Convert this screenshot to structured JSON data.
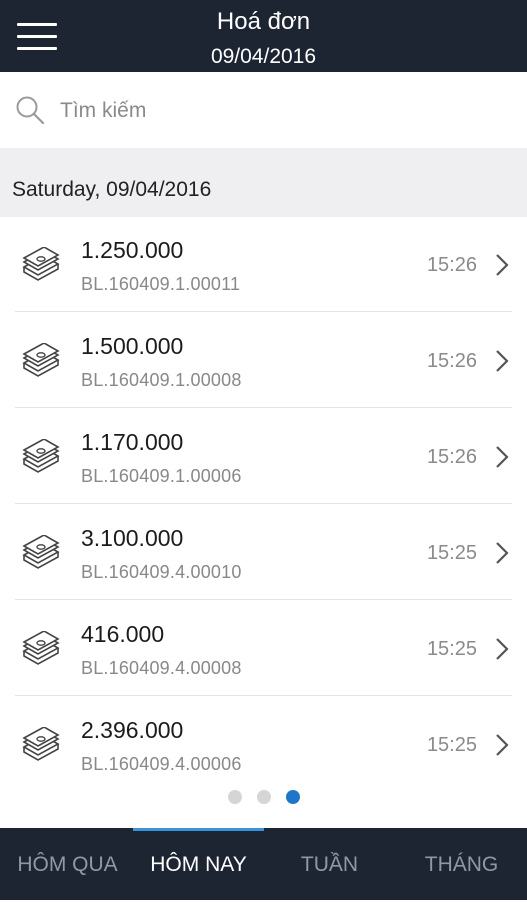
{
  "header": {
    "title": "Hoá đơn",
    "date": "09/04/2016"
  },
  "search": {
    "placeholder": "Tìm kiếm",
    "icon": "search-icon"
  },
  "section": {
    "label": "Saturday, 09/04/2016"
  },
  "invoices": [
    {
      "amount": "1.250.000",
      "code": "BL.160409.1.00011",
      "time": "15:26"
    },
    {
      "amount": "1.500.000",
      "code": "BL.160409.1.00008",
      "time": "15:26"
    },
    {
      "amount": "1.170.000",
      "code": "BL.160409.1.00006",
      "time": "15:26"
    },
    {
      "amount": "3.100.000",
      "code": "BL.160409.4.00010",
      "time": "15:25"
    },
    {
      "amount": "416.000",
      "code": "BL.160409.4.00008",
      "time": "15:25"
    },
    {
      "amount": "2.396.000",
      "code": "BL.160409.4.00006",
      "time": "15:25"
    }
  ],
  "pager": {
    "count": 3,
    "active_index": 2
  },
  "tabs": [
    {
      "label": "HÔM QUA"
    },
    {
      "label": "HÔM NAY"
    },
    {
      "label": "TUẦN"
    },
    {
      "label": "THÁNG"
    }
  ],
  "active_tab": 1,
  "colors": {
    "bar_background": "#1d2533",
    "accent": "#1d76c9",
    "tab_indicator": "#3a95d8"
  }
}
